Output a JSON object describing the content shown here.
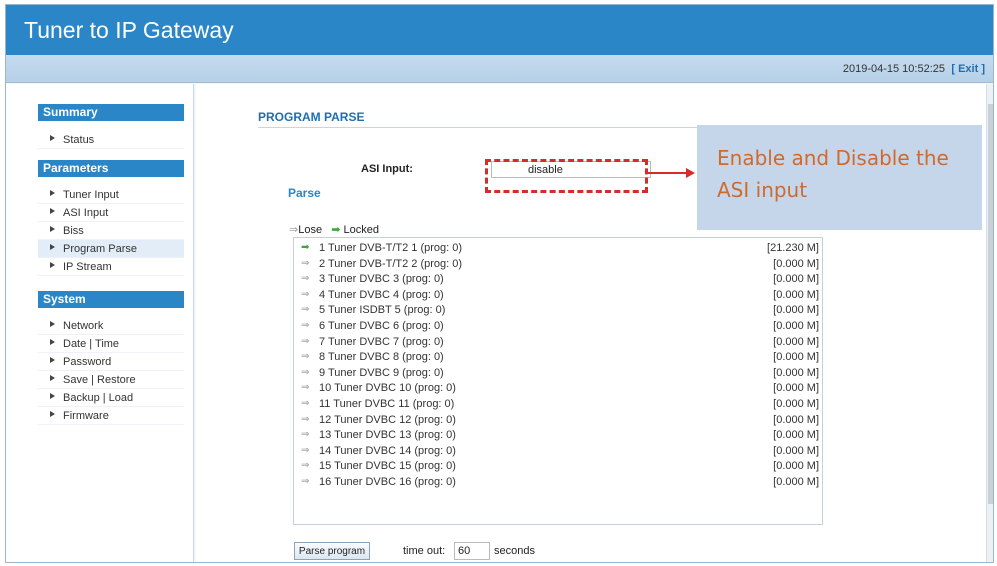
{
  "app": {
    "title": "Tuner to IP Gateway"
  },
  "infobar": {
    "datetime": "2019-04-15 10:52:25",
    "exit_label": "[ Exit ]"
  },
  "sidebar": {
    "summary": {
      "heading": "Summary",
      "items": [
        {
          "label": "Status"
        }
      ]
    },
    "parameters": {
      "heading": "Parameters",
      "items": [
        {
          "label": "Tuner Input"
        },
        {
          "label": "ASI Input"
        },
        {
          "label": "Biss"
        },
        {
          "label": "Program Parse"
        },
        {
          "label": "IP Stream"
        }
      ]
    },
    "system": {
      "heading": "System",
      "items": [
        {
          "label": "Network"
        },
        {
          "label": "Date | Time"
        },
        {
          "label": "Password"
        },
        {
          "label": "Save | Restore"
        },
        {
          "label": "Backup | Load"
        },
        {
          "label": "Firmware"
        }
      ]
    }
  },
  "main": {
    "page_title": "PROGRAM PARSE",
    "asi": {
      "label": "ASI Input:",
      "value": "disable"
    },
    "parse_heading": "Parse",
    "legend": {
      "lose_label": "Lose",
      "locked_label": "Locked",
      "lose_color": "#999999",
      "locked_color": "#3aa83a"
    },
    "tuners": [
      {
        "name": "1 Tuner DVB-T/T2 1 (prog: 0)",
        "rate": "[21.230 M]",
        "status": "locked"
      },
      {
        "name": "2 Tuner DVB-T/T2 2 (prog: 0)",
        "rate": "[0.000 M]",
        "status": "lose"
      },
      {
        "name": "3 Tuner DVBC 3 (prog: 0)",
        "rate": "[0.000 M]",
        "status": "lose"
      },
      {
        "name": "4 Tuner DVBC 4 (prog: 0)",
        "rate": "[0.000 M]",
        "status": "lose"
      },
      {
        "name": "5 Tuner ISDBT 5 (prog: 0)",
        "rate": "[0.000 M]",
        "status": "lose"
      },
      {
        "name": "6 Tuner DVBC 6 (prog: 0)",
        "rate": "[0.000 M]",
        "status": "lose"
      },
      {
        "name": "7 Tuner DVBC 7 (prog: 0)",
        "rate": "[0.000 M]",
        "status": "lose"
      },
      {
        "name": "8 Tuner DVBC 8 (prog: 0)",
        "rate": "[0.000 M]",
        "status": "lose"
      },
      {
        "name": "9 Tuner DVBC 9 (prog: 0)",
        "rate": "[0.000 M]",
        "status": "lose"
      },
      {
        "name": "10 Tuner DVBC 10 (prog: 0)",
        "rate": "[0.000 M]",
        "status": "lose"
      },
      {
        "name": "11 Tuner DVBC 11 (prog: 0)",
        "rate": "[0.000 M]",
        "status": "lose"
      },
      {
        "name": "12 Tuner DVBC 12 (prog: 0)",
        "rate": "[0.000 M]",
        "status": "lose"
      },
      {
        "name": "13 Tuner DVBC 13 (prog: 0)",
        "rate": "[0.000 M]",
        "status": "lose"
      },
      {
        "name": "14 Tuner DVBC 14 (prog: 0)",
        "rate": "[0.000 M]",
        "status": "lose"
      },
      {
        "name": "15 Tuner DVBC 15 (prog: 0)",
        "rate": "[0.000 M]",
        "status": "lose"
      },
      {
        "name": "16 Tuner DVBC 16 (prog: 0)",
        "rate": "[0.000 M]",
        "status": "lose"
      }
    ],
    "parse_button_label": "Parse program",
    "timeout_label": "time out:",
    "timeout_value": "60",
    "seconds_label": "seconds"
  },
  "annotation": {
    "text": "Enable and Disable the ASI input",
    "color": "#d06a2c",
    "background": "#c5d6ea",
    "marker_color": "#d62b2b"
  }
}
